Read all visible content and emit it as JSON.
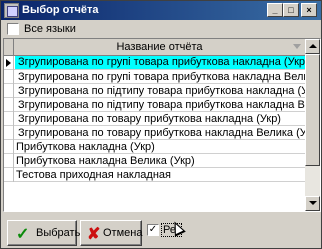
{
  "window": {
    "title": "Выбор отчёта",
    "controls": {
      "minimize": "_",
      "maximize": "□",
      "close": "×"
    }
  },
  "filter": {
    "all_languages_label": "Все языки",
    "all_languages_checked": false
  },
  "grid": {
    "column_header": "Название отчёта",
    "rows": [
      {
        "label": "Згрупирована по групі товара прибуткова накладна (Укр)",
        "selected": true
      },
      {
        "label": "Згрупирована по групі товара прибуткова накладна Велика (Укр)",
        "selected": false
      },
      {
        "label": "Згрупирована по підтипу товара прибуткова накладна (Укр)",
        "selected": false
      },
      {
        "label": "Згрупирована по підтипу товара прибуткова накладна Велика (Укр)",
        "selected": false
      },
      {
        "label": "Згрупирована по товару прибуткова накладна (Укр)",
        "selected": false
      },
      {
        "label": "Згрупирована по товару прибуткова накладна Велика (Укр)",
        "selected": false
      },
      {
        "label": "Прибуткова накладна (Укр)",
        "selected": false
      },
      {
        "label": "Прибуткова накладна Велика (Укр)",
        "selected": false
      },
      {
        "label": "Тестова приходная накладная",
        "selected": false
      }
    ]
  },
  "footer": {
    "select_label": "Выбрать",
    "cancel_label": "Отмена",
    "reg_label": "Рег",
    "reg_checked": true,
    "check_mark": "✓"
  },
  "icons": {
    "select": "check-icon",
    "cancel": "x-icon"
  },
  "colors": {
    "selection": "#00ffff",
    "titlebar": "#0a246a"
  }
}
